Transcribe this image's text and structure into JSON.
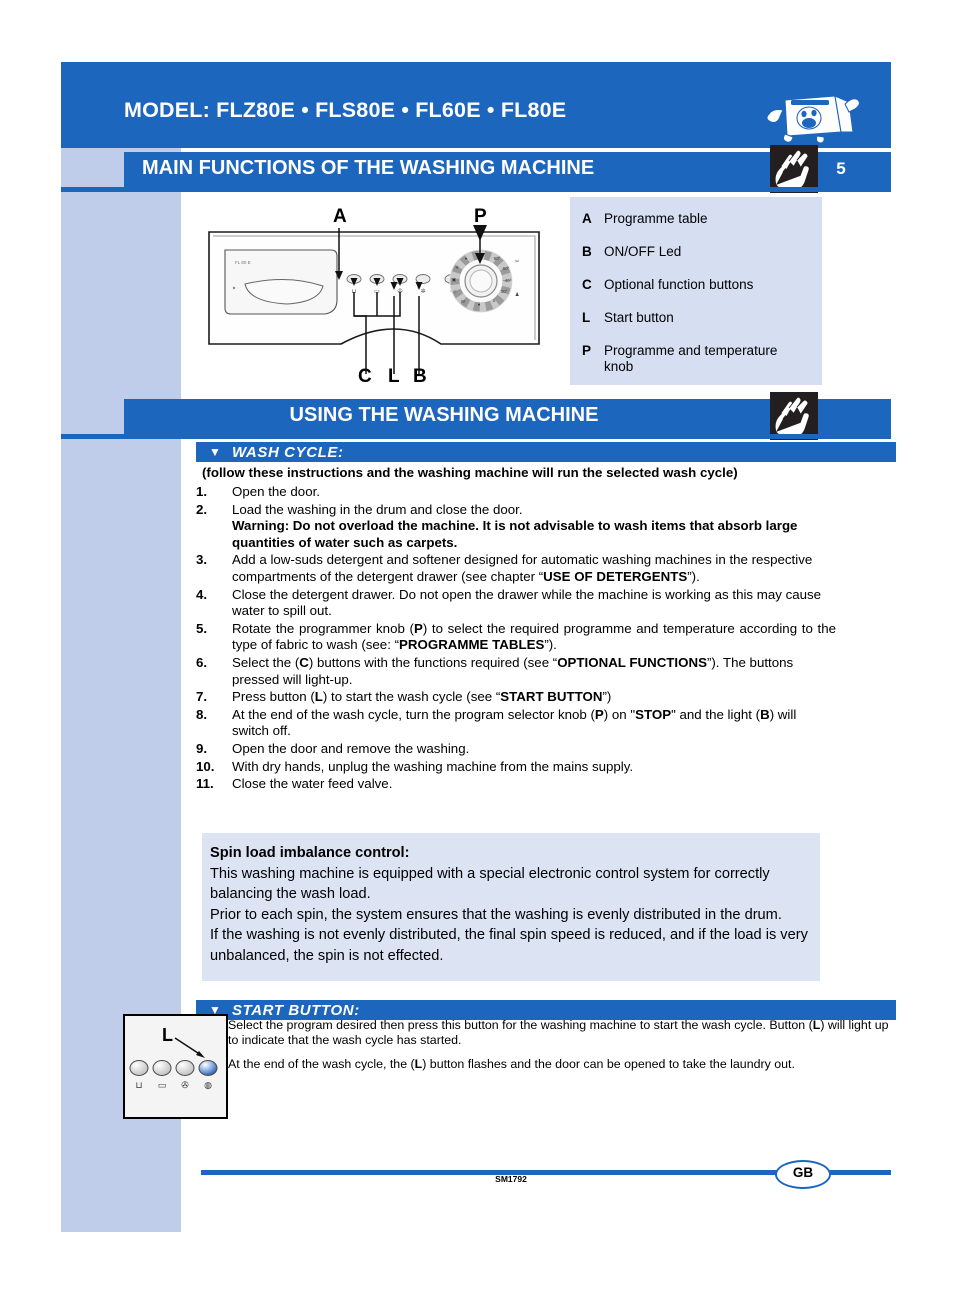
{
  "header": {
    "model_label": "MODEL: FLZ80E • FLS80E • FL60E • FL80E",
    "mascot_icon": "washing-machine-mascot-icon"
  },
  "section1": {
    "title": "MAIN FUNCTIONS OF THE WASHING MACHINE",
    "page_number": "5",
    "hand_icon": "pointing-hand-icon"
  },
  "diagram": {
    "callouts": {
      "a": "A",
      "p": "P",
      "c": "C",
      "l": "L",
      "b": "B"
    },
    "machine_icon": "washing-machine-front-panel-icon",
    "knob_icon": "programme-knob-icon"
  },
  "legend": {
    "items": [
      {
        "key": "A",
        "text": "Programme table"
      },
      {
        "key": "B",
        "text": "ON/OFF Led"
      },
      {
        "key": "C",
        "text": "Optional function buttons"
      },
      {
        "key": "L",
        "text": "Start button"
      },
      {
        "key": "P",
        "text": "Programme and temperature knob"
      }
    ]
  },
  "section2": {
    "title": "USING THE WASHING MACHINE",
    "hand_icon": "pointing-hand-icon"
  },
  "wash_cycle": {
    "bar_label": "WASH CYCLE:",
    "triangle_icon": "triangle-down-icon",
    "intro": "(follow these instructions and the washing machine will run the selected wash cycle)",
    "steps": [
      {
        "num": "1.",
        "html": "Open the door."
      },
      {
        "num": "2.",
        "html": "Load the washing in the drum and close the door.<br><span class=\"warn\">Warning: Do not overload the machine. It is not advisable to wash items that absorb large quantities of water such as carpets.</span>"
      },
      {
        "num": "3.",
        "html": "Add a low-suds detergent and softener designed for automatic washing machines in the respective compartments of the detergent drawer (see chapter “<b>USE OF DETERGENTS</b>”)."
      },
      {
        "num": "4.",
        "html": "Close the detergent drawer. Do not open the drawer while the machine is working as this may cause water to spill out."
      },
      {
        "num": "5.",
        "html": "Rotate the programmer knob (<b>P</b>) to select the required programme and temperature according to the type of fabric to wash (see: “<b>PROGRAMME TABLES</b>”).",
        "justify": true
      },
      {
        "num": "6.",
        "html": "Select the (<b>C</b>) buttons with the functions required (see “<b>OPTIONAL FUNCTIONS</b>”). The buttons pressed will light-up."
      },
      {
        "num": "7.",
        "html": "Press button (<b>L</b>) to start the wash cycle (see “<b>START BUTTON</b>”)"
      },
      {
        "num": "8.",
        "html": "At the end of the wash cycle, turn the program selector knob (<b>P</b>) on \"<b>STOP</b>\" and the light (<b>B</b>) will switch off."
      },
      {
        "num": "9.",
        "html": "Open the door and remove the washing."
      },
      {
        "num": "10.",
        "html": "With dry hands, unplug the washing machine from the mains supply."
      },
      {
        "num": "11.",
        "html": "Close the water feed valve."
      }
    ]
  },
  "spin_box": {
    "heading": "Spin load imbalance control:",
    "paragraphs": [
      "This washing machine is equipped with a special electronic control system for correctly balancing the wash load.",
      "Prior to each spin, the system ensures that the washing is evenly distributed in the drum.",
      "If the washing is not evenly distributed, the final spin speed is reduced, and if the load is very unbalanced, the spin is not effected."
    ]
  },
  "start_button": {
    "bar_label": "START BUTTON:",
    "triangle_icon": "triangle-down-icon",
    "illustration": {
      "callout": "L",
      "icon": "start-button-panel-icon"
    },
    "paragraphs": [
      "Select the program desired then press this button for the washing machine to start the wash cycle. Button (<b>L</b>) will light up to indicate that the wash cycle has started.",
      "At the end of the wash cycle, the (<b>L</b>) button flashes and the door can be opened to take the laundry out."
    ]
  },
  "footer": {
    "code": "SM1792",
    "locale_badge": "GB"
  },
  "colors": {
    "brand_blue": "#1d66bd",
    "band_blue": "#bfcdea",
    "legend_blue": "#d6dff2",
    "box_blue": "#dce3f3"
  }
}
